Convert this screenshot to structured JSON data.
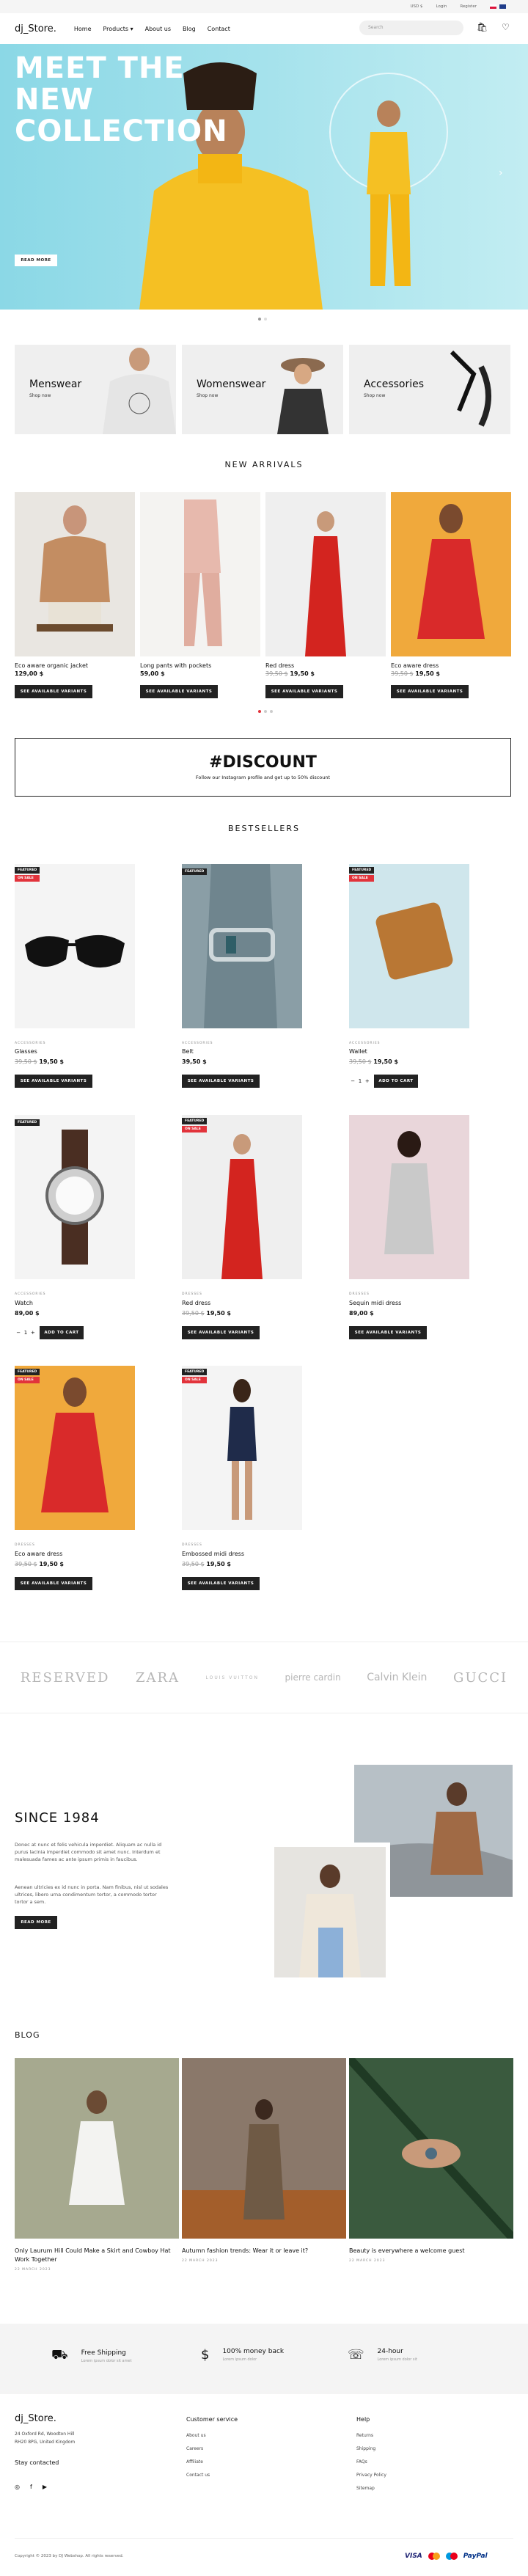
{
  "topbar": {
    "currency": "USD $",
    "login": "Login",
    "register": "Register"
  },
  "header": {
    "logo": "dj_Store.",
    "nav": [
      "Home",
      "Products",
      "About us",
      "Blog",
      "Contact"
    ],
    "search_placeholder": "Search"
  },
  "hero": {
    "title": "MEET THE NEW COLLECTION",
    "button": "READ MORE"
  },
  "categories": [
    {
      "title": "Menswear",
      "sub": "Shop now"
    },
    {
      "title": "Womenswear",
      "sub": "Shop now"
    },
    {
      "title": "Accessories",
      "sub": "Shop now"
    }
  ],
  "new_arrivals": {
    "title": "NEW ARRIVALS",
    "items": [
      {
        "name": "Eco aware organic jacket",
        "price": "129,00 $",
        "old": "",
        "button": "SEE AVAILABLE VARIANTS"
      },
      {
        "name": "Long pants with pockets",
        "price": "59,00 $",
        "old": "",
        "button": "SEE AVAILABLE VARIANTS"
      },
      {
        "name": "Red dress",
        "price": "19,50 $",
        "old": "39,50 $",
        "button": "SEE AVAILABLE VARIANTS"
      },
      {
        "name": "Eco aware dress",
        "price": "19,50 $",
        "old": "39,50 $",
        "button": "SEE AVAILABLE VARIANTS"
      }
    ]
  },
  "discount": {
    "title": "#DISCOUNT",
    "text": "Follow our Instagram profile and get up to 50% discount"
  },
  "bestsellers": {
    "title": "BESTSELLERS",
    "items": [
      {
        "cat": "ACCESSORIES",
        "name": "Glasses",
        "price": "19,50 $",
        "old": "39,50 $",
        "button": "SEE AVAILABLE VARIANTS",
        "tags": [
          "FEATURED",
          "ON SALE"
        ]
      },
      {
        "cat": "ACCESSORIES",
        "name": "Belt",
        "price": "39,50 $",
        "old": "",
        "button": "SEE AVAILABLE VARIANTS",
        "tags": [
          "FEATURED"
        ]
      },
      {
        "cat": "ACCESSORIES",
        "name": "Wallet",
        "price": "19,50 $",
        "old": "39,50 $",
        "button": "ADD TO CART",
        "tags": [
          "FEATURED",
          "ON SALE"
        ],
        "qty": "1"
      },
      {
        "cat": "ACCESSORIES",
        "name": "Watch",
        "price": "89,00 $",
        "old": "",
        "button": "ADD TO CART",
        "tags": [
          "FEATURED"
        ],
        "qty": "1"
      },
      {
        "cat": "DRESSES",
        "name": "Red dress",
        "price": "19,50 $",
        "old": "39,50 $",
        "button": "SEE AVAILABLE VARIANTS",
        "tags": [
          "FEATURED",
          "ON SALE"
        ]
      },
      {
        "cat": "DRESSES",
        "name": "Sequin midi dress",
        "price": "89,00 $",
        "old": "",
        "button": "SEE AVAILABLE VARIANTS",
        "tags": []
      },
      {
        "cat": "DRESSES",
        "name": "Eco aware dress",
        "price": "19,50 $",
        "old": "39,50 $",
        "button": "SEE AVAILABLE VARIANTS",
        "tags": [
          "FEATURED",
          "ON SALE"
        ]
      },
      {
        "cat": "DRESSES",
        "name": "Embossed midi dress",
        "price": "19,50 $",
        "old": "39,50 $",
        "button": "SEE AVAILABLE VARIANTS",
        "tags": [
          "FEATURED",
          "ON SALE"
        ]
      }
    ]
  },
  "brands": [
    "RESERVED",
    "ZARA",
    "LOUIS VUITTON",
    "pierre cardin",
    "Calvin Klein",
    "GUCCI"
  ],
  "since": {
    "title": "SINCE 1984",
    "p1": "Donec at nunc et felis vehicula imperdiet. Aliquam ac nulla id purus lacinia imperdiet commodo sit amet nunc. Interdum et malesuada fames ac ante ipsum primis in faucibus.",
    "p2": "Aenean ultricies ex id nunc in porta. Nam finibus, nisl ut sodales ultrices, libero urna condimentum tortor, a commodo tortor tortor a sem.",
    "button": "READ MORE"
  },
  "blog": {
    "title": "BLOG",
    "posts": [
      {
        "title": "Only Laurum Hill Could Make a Skirt and Cowboy Hat Work Together",
        "date": "22 MARCH 2023"
      },
      {
        "title": "Autumn fashion trends: Wear it or leave it?",
        "date": "22 MARCH 2023"
      },
      {
        "title": "Beauty is everywhere a welcome guest",
        "date": "22 MARCH 2023"
      }
    ]
  },
  "features": [
    {
      "title": "Free Shipping",
      "sub": "Lorem ipsum dolor sit amet"
    },
    {
      "title": "100% money back",
      "sub": "Lorem ipsum dolor"
    },
    {
      "title": "24-hour",
      "sub": "Lorem ipsum dolor sit"
    }
  ],
  "footer": {
    "logo": "dj_Store.",
    "address": [
      "24 Oxford Rd, Woodton Hill",
      "RH20 8PG, United Kingdom"
    ],
    "stay": "Stay contacted",
    "col1_title": "Customer service",
    "col1": [
      "About us",
      "Careers",
      "Affiliate",
      "Contact us"
    ],
    "col2_title": "Help",
    "col2": [
      "Returns",
      "Shipping",
      "FAQs",
      "Privacy Policy",
      "Sitemap"
    ],
    "copyright": "Copyright © 2023 by DJ Webshop. All rights reserved.",
    "payments": [
      "VISA",
      "PayPal"
    ]
  },
  "colors": {
    "accent": "#222222",
    "sale": "#e2333b",
    "hero_bg": "#a5e2ec"
  }
}
